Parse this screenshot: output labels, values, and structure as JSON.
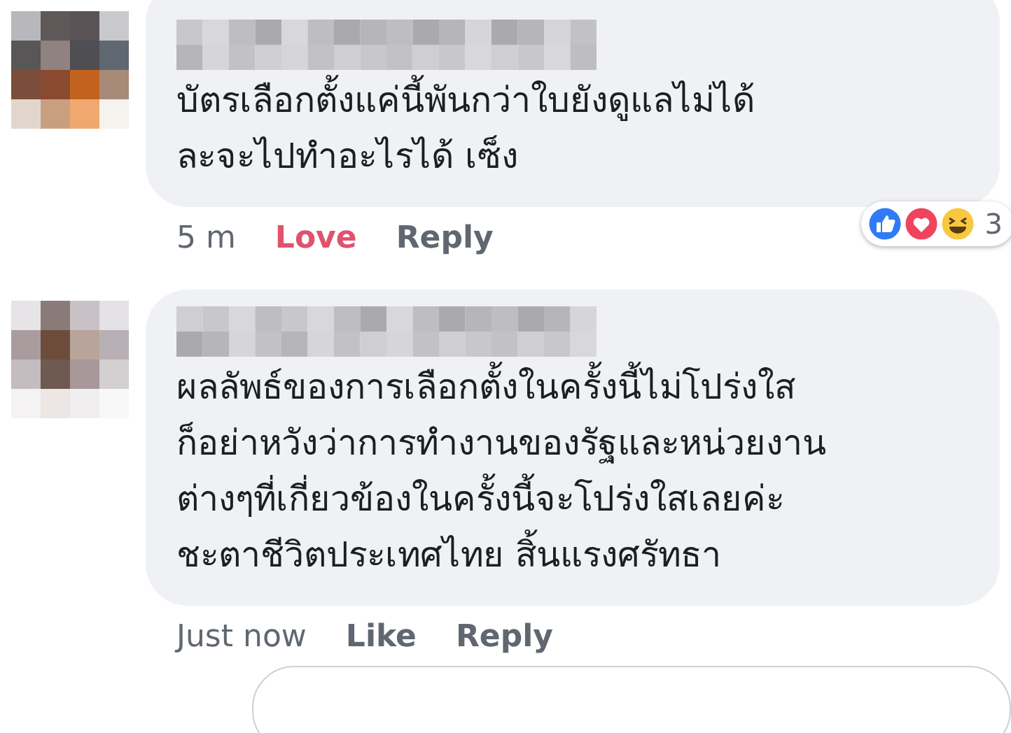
{
  "comments": [
    {
      "text_lines": [
        "บัตรเลือกตั้งแค่นี้พันกว่าใบยังดูแลไม่ได้",
        "ละจะไปทำอะไรได้ เซ็ง"
      ],
      "time": "5 m",
      "reaction_action": {
        "label": "Love",
        "selected": true
      },
      "reply": "Reply",
      "reactions": {
        "count": "3"
      }
    },
    {
      "text_lines": [
        "ผลลัพธ์ของการเลือกตั้งในครั้งนี้ไม่โปร่งใส",
        "ก็อย่าหวังว่าการทำงานของรัฐและหน่วยงาน",
        "ต่างๆที่เกี่ยวข้องในครั้งนี้จะโปร่งใสเลยค่ะ",
        "ชะตาชีวิตประเทศไทย สิ้นแรงศรัทธา"
      ],
      "time": "Just now",
      "reaction_action": {
        "label": "Like",
        "selected": false
      },
      "reply": "Reply"
    }
  ]
}
